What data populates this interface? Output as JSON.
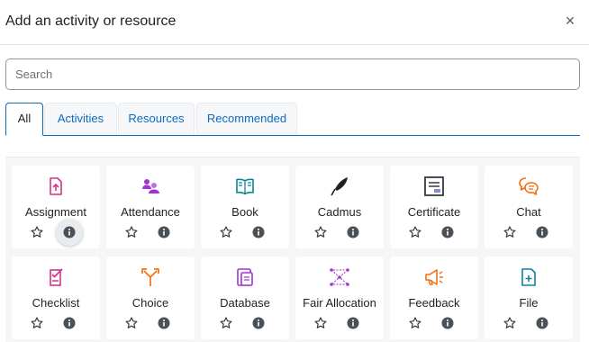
{
  "modal": {
    "title": "Add an activity or resource",
    "close_symbol": "×"
  },
  "search": {
    "placeholder": "Search",
    "value": ""
  },
  "tabs": [
    {
      "label": "All",
      "active": true
    },
    {
      "label": "Activities",
      "active": false
    },
    {
      "label": "Resources",
      "active": false
    },
    {
      "label": "Recommended",
      "active": false
    }
  ],
  "colors": {
    "accent": "#0f6cbf",
    "assessment": "#d63384",
    "collaboration": "#a233d6",
    "content": "#0d8397",
    "communication": "#f76e12",
    "neutral": "#343a40"
  },
  "modules": [
    {
      "label": "Assignment",
      "icon": "assignment-icon"
    },
    {
      "label": "Attendance",
      "icon": "attendance-icon"
    },
    {
      "label": "Book",
      "icon": "book-icon"
    },
    {
      "label": "Cadmus",
      "icon": "cadmus-icon"
    },
    {
      "label": "Certificate",
      "icon": "certificate-icon"
    },
    {
      "label": "Chat",
      "icon": "chat-icon"
    },
    {
      "label": "Checklist",
      "icon": "checklist-icon"
    },
    {
      "label": "Choice",
      "icon": "choice-icon"
    },
    {
      "label": "Database",
      "icon": "database-icon"
    },
    {
      "label": "Fair Allocation",
      "icon": "fair-allocation-icon"
    },
    {
      "label": "Feedback",
      "icon": "feedback-icon"
    },
    {
      "label": "File",
      "icon": "file-icon"
    }
  ]
}
